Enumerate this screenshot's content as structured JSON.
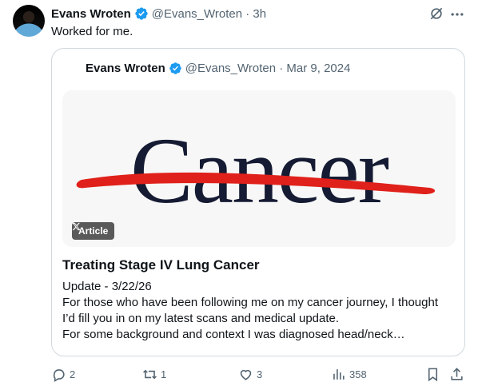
{
  "tweet": {
    "author_name": "Evans Wroten",
    "handle_time": "@Evans_Wroten · 3h",
    "text": "Worked for me."
  },
  "quoted": {
    "author_name": "Evans Wroten",
    "handle_date": "@Evans_Wroten · Mar 9, 2024",
    "image_word": "Cancer",
    "badge_label": "Article",
    "title": "Treating Stage IV Lung Cancer",
    "body_lines": [
      "Update - 3/22/26",
      "For those who have been following me on my cancer journey, I thought",
      "I’d fill you in on my latest scans and medical update.",
      "For some background and context I was diagnosed head/neck…"
    ]
  },
  "actions": {
    "replies": "2",
    "reposts": "1",
    "likes": "3",
    "views": "358"
  },
  "colors": {
    "verified": "#1d9bf0",
    "muted": "#536471",
    "strike": "#e0201a",
    "image_text": "#151b33"
  },
  "icons": [
    "verified-badge-icon",
    "grok-icon",
    "more-icon",
    "x-logo-icon",
    "reply-icon",
    "repost-icon",
    "like-icon",
    "views-icon",
    "bookmark-icon",
    "share-icon"
  ]
}
